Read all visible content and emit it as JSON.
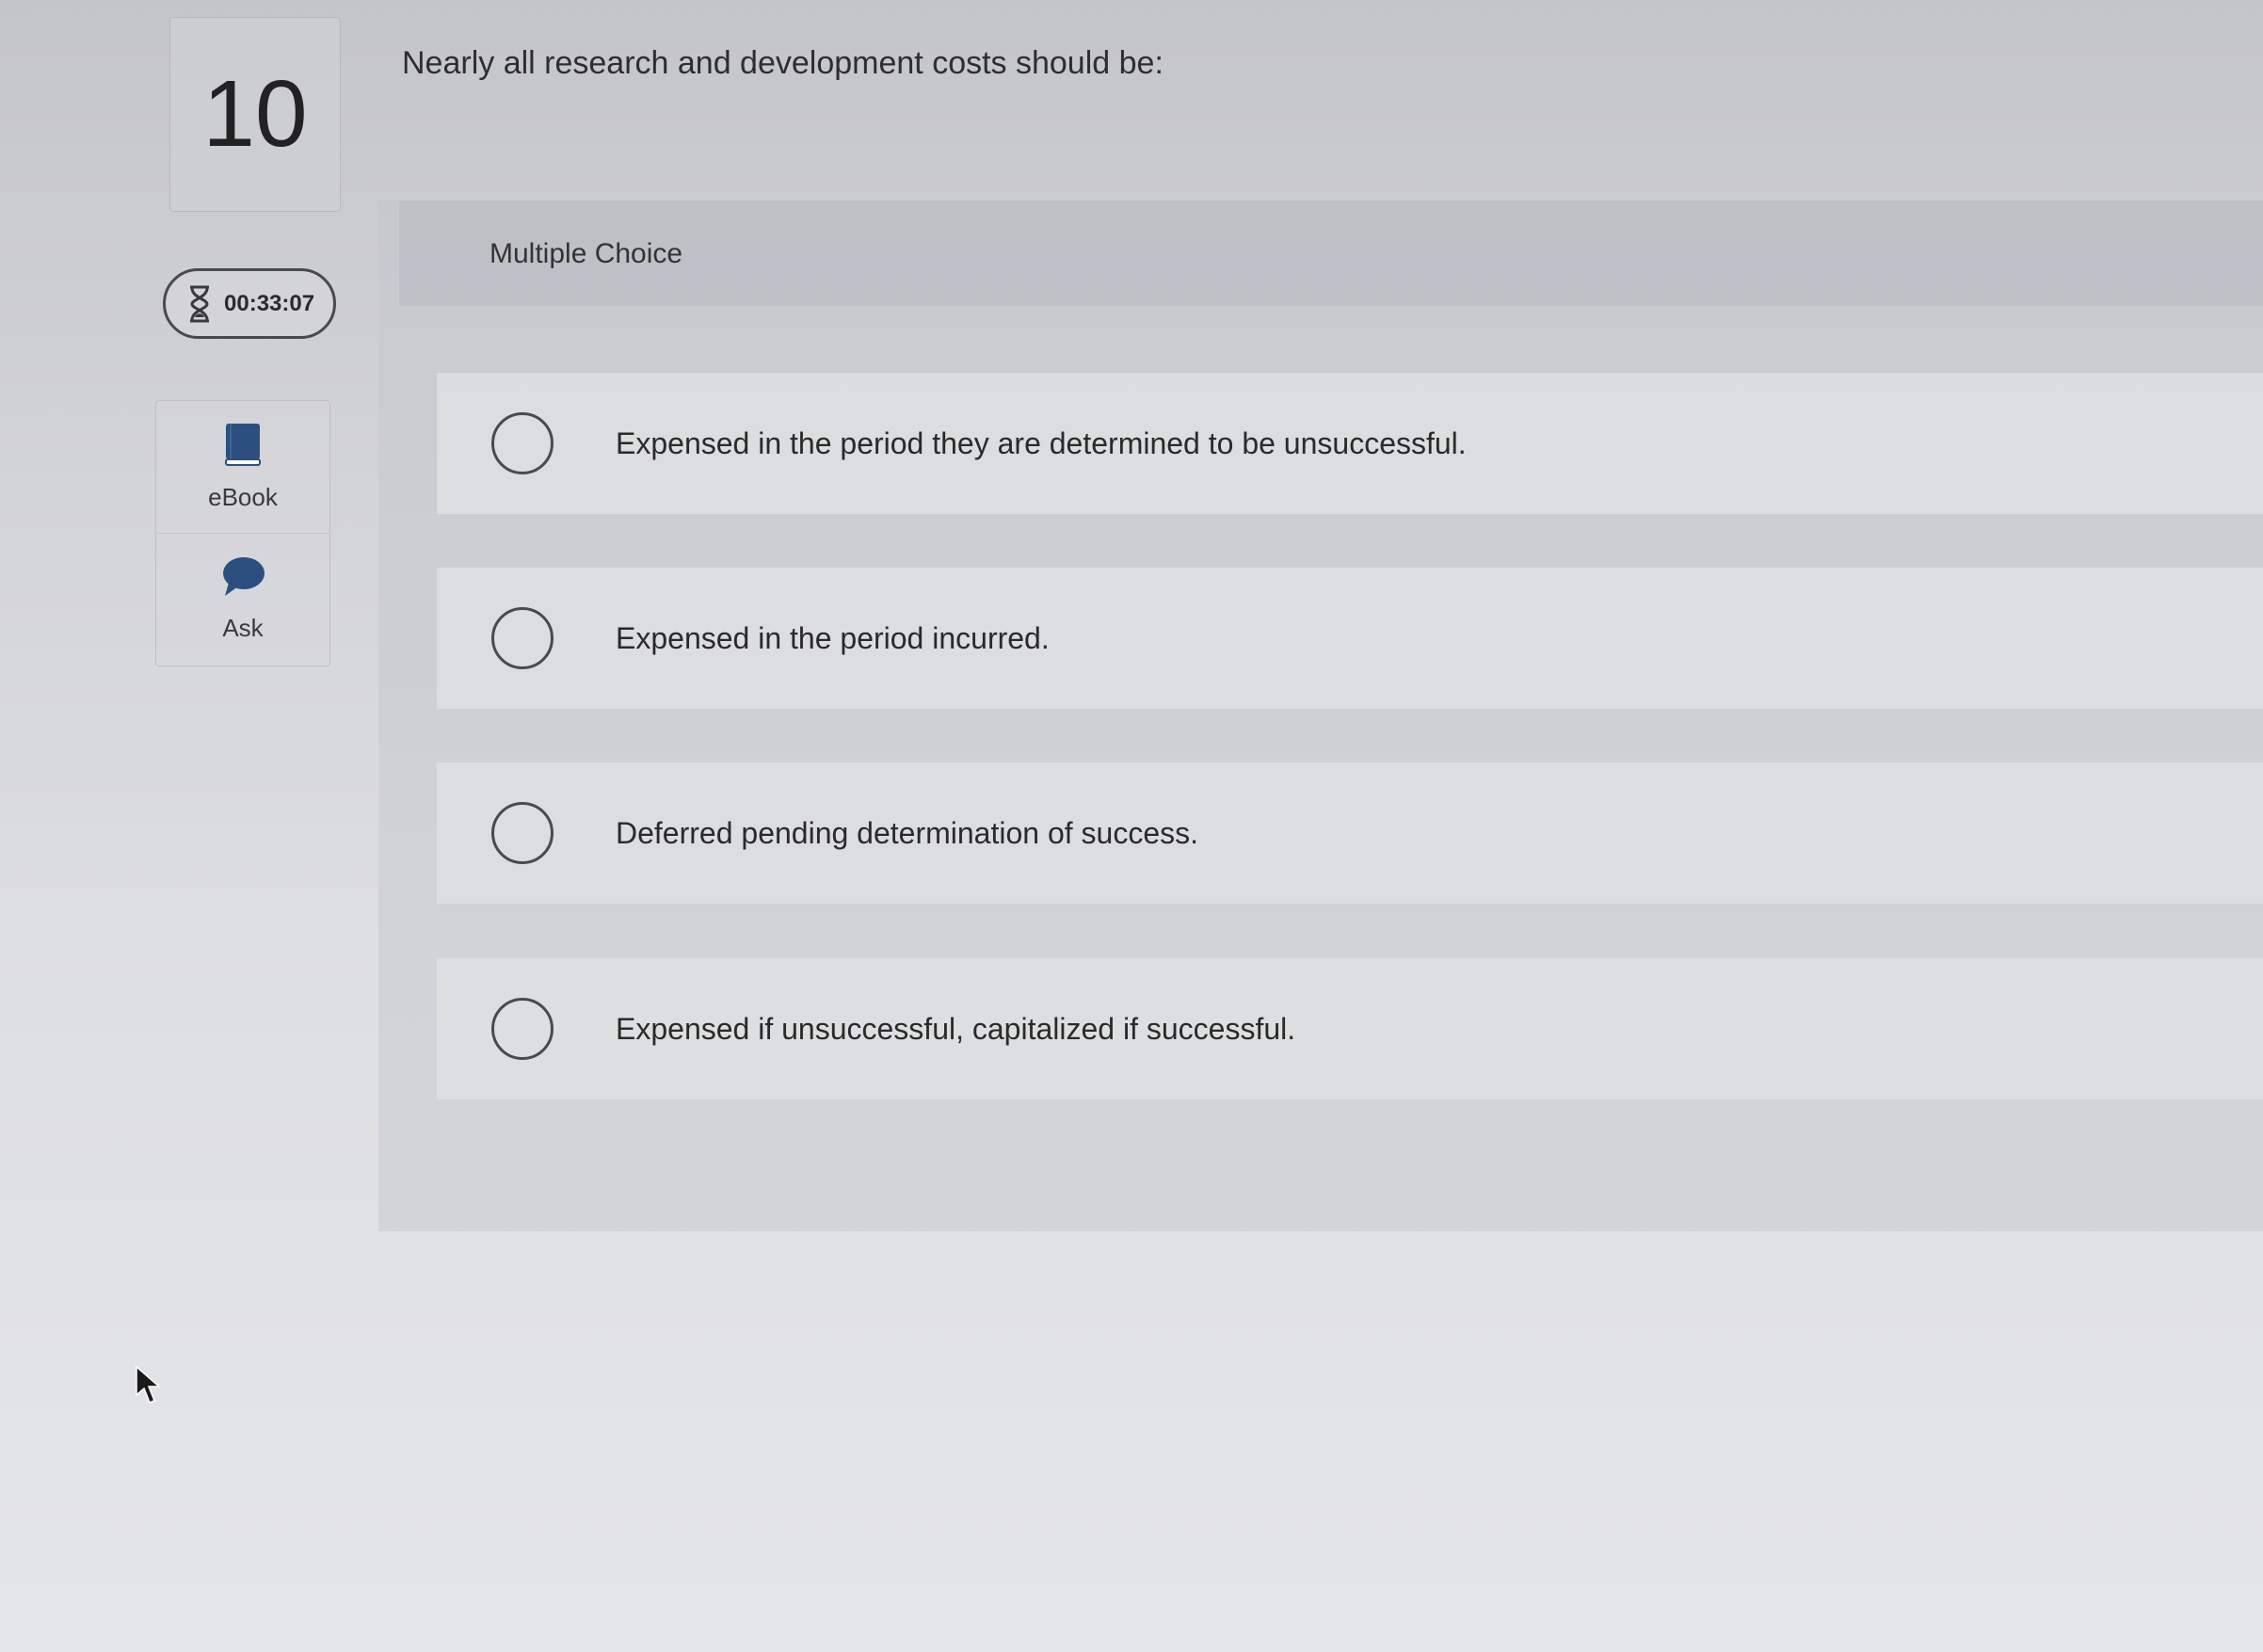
{
  "question": {
    "number": "10",
    "text": "Nearly all research and development costs should be:"
  },
  "timer": {
    "icon": "hourglass-icon",
    "value": "00:33:07"
  },
  "tools": [
    {
      "label": "eBook",
      "icon": "book-icon"
    },
    {
      "label": "Ask",
      "icon": "speech-bubble-icon"
    }
  ],
  "answer_panel": {
    "type_label": "Multiple Choice",
    "options": [
      {
        "text": "Expensed in the period they are determined to be unsuccessful.",
        "selected": false
      },
      {
        "text": "Expensed in the period incurred.",
        "selected": false
      },
      {
        "text": "Deferred pending determination of success.",
        "selected": false
      },
      {
        "text": "Expensed if unsuccessful, capitalized if successful.",
        "selected": false
      }
    ]
  },
  "colors": {
    "tool_icon": "#2b4f7e",
    "background": "#d6d7db"
  }
}
